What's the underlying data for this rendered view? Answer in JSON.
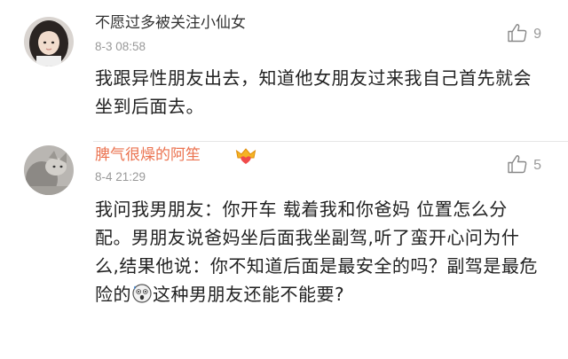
{
  "comments": [
    {
      "username": "不愿过多被关注小仙女",
      "time": "8-3 08:58",
      "likes": "9",
      "text": "我跟异性朋友出去，知道他女朋友过来我自己首先就会坐到后面去。"
    },
    {
      "username": "脾气很燥的阿笙",
      "time": "8-4 21:29",
      "likes": "5",
      "text_before_emoji": "我问我男朋友：你开车 载着我和你爸妈 位置怎么分配。男朋友说爸妈坐后面我坐副驾,听了蛮开心问为什么,结果他说：你不知道后面是最安全的吗？副驾是最危险的",
      "text_after_emoji": "这种男朋友还能不能要?"
    }
  ],
  "colors": {
    "username_highlight": "#eb7350",
    "meta_gray": "#999999"
  },
  "icons": {
    "like": "thumbs-up-icon",
    "vip_badge": "crown-heart-icon",
    "emoji": "shocked-face-emoji"
  }
}
